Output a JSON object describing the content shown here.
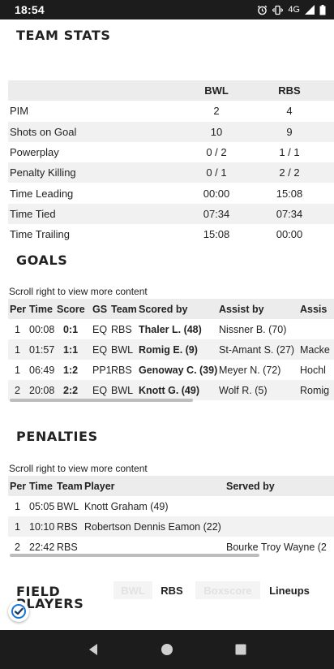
{
  "status_bar": {
    "time": "18:54",
    "network": "4G",
    "icons": [
      "alarm-icon",
      "vibrate-icon",
      "signal-icon",
      "battery-icon"
    ]
  },
  "team_stats": {
    "title": "TEAM STATS",
    "team_a": "BWL",
    "team_b": "RBS",
    "rows": [
      {
        "label": "PIM",
        "a": "2",
        "b": "4"
      },
      {
        "label": "Shots on Goal",
        "a": "10",
        "b": "9"
      },
      {
        "label": "Powerplay",
        "a": "0 / 2",
        "b": "1 / 1"
      },
      {
        "label": "Penalty Killing",
        "a": "0 / 1",
        "b": "2 / 2"
      },
      {
        "label": "Time Leading",
        "a": "00:00",
        "b": "15:08"
      },
      {
        "label": "Time Tied",
        "a": "07:34",
        "b": "07:34"
      },
      {
        "label": "Time Trailing",
        "a": "15:08",
        "b": "00:00"
      }
    ]
  },
  "goals": {
    "title": "GOALS",
    "scroll_hint": "Scroll right to view more content",
    "columns": [
      "Per",
      "Time",
      "Score",
      "GS",
      "Team",
      "Scored by",
      "Assist by",
      "Assis"
    ],
    "rows": [
      {
        "per": "1",
        "time": "00:08",
        "score": "0:1",
        "gs": "EQ",
        "team": "RBS",
        "scored_by": "Thaler L. (48)",
        "assist1": "Nissner B. (70)",
        "assist2": ""
      },
      {
        "per": "1",
        "time": "01:57",
        "score": "1:1",
        "gs": "EQ",
        "team": "BWL",
        "scored_by": "Romig E. (9)",
        "assist1": "St-Amant S. (27)",
        "assist2": "Macke"
      },
      {
        "per": "1",
        "time": "06:49",
        "score": "1:2",
        "gs": "PP1",
        "team": "RBS",
        "scored_by": "Genoway C. (39)",
        "assist1": "Meyer N. (72)",
        "assist2": "Hochl"
      },
      {
        "per": "2",
        "time": "20:08",
        "score": "2:2",
        "gs": "EQ",
        "team": "BWL",
        "scored_by": "Knott G. (49)",
        "assist1": "Wolf R. (5)",
        "assist2": "Romig"
      }
    ]
  },
  "penalties": {
    "title": "PENALTIES",
    "scroll_hint": "Scroll right to view more content",
    "columns": [
      "Per",
      "Time",
      "Team",
      "Player",
      "Served by"
    ],
    "rows": [
      {
        "per": "1",
        "time": "05:05",
        "team": "BWL",
        "player": "Knott Graham (49)",
        "served_by": ""
      },
      {
        "per": "1",
        "time": "10:10",
        "team": "RBS",
        "player": "Robertson Dennis Eamon (22)",
        "served_by": ""
      },
      {
        "per": "2",
        "time": "22:42",
        "team": "RBS",
        "player": "",
        "served_by": "Bourke Troy Wayne (2"
      }
    ]
  },
  "field_players": {
    "title_line1": "FIELD",
    "title_line2": "PLAYERS",
    "team_toggle": [
      "BWL",
      "RBS"
    ],
    "team_selected": "RBS",
    "view_toggle": [
      "Boxscore",
      "Lineups"
    ],
    "view_selected": "Lineups"
  },
  "nav": {
    "icons": [
      "back-icon",
      "home-icon",
      "recents-icon"
    ]
  }
}
